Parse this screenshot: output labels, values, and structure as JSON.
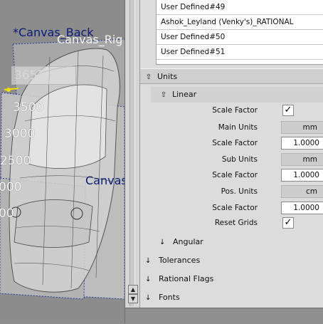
{
  "viewport": {
    "canvas_back_label": "*Canvas_Back",
    "canvas_right_label": "Canvas_Rig",
    "canvas_side_label": "Canvas",
    "readout": "3651.05",
    "ruler": [
      "3500",
      "3000",
      "2500",
      "000",
      "00"
    ]
  },
  "list": {
    "items": [
      "User Defined#49",
      "Ashok_Leyland (Venky's)_RATIONAL",
      "User Defined#50",
      "User Defined#51"
    ]
  },
  "units": {
    "header": "Units",
    "linear": {
      "header": "Linear",
      "scale_factor_label": "Scale Factor",
      "main_units_label": "Main Units",
      "main_units_value": "mm",
      "main_scale_label": "Scale Factor",
      "main_scale_value": "1.0000",
      "sub_units_label": "Sub Units",
      "sub_units_value": "mm",
      "sub_scale_label": "Scale Factor",
      "sub_scale_value": "1.0000",
      "pos_units_label": "Pos. Units",
      "pos_units_value": "cm",
      "pos_scale_label": "Scale Factor",
      "pos_scale_value": "1.0000",
      "reset_grids_label": "Reset Grids",
      "checkmark": "✓"
    },
    "angular": "Angular"
  },
  "sections": {
    "tolerances": "Tolerances",
    "rational_flags": "Rational Flags",
    "fonts": "Fonts"
  },
  "icons": {
    "expanded": "⇧",
    "collapsed": "↓",
    "scroll_up": "▲",
    "scroll_down": "▼"
  }
}
